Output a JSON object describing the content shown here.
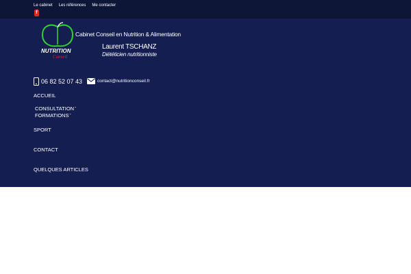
{
  "topbar": {
    "links": [
      "Le cabinet",
      "Les références",
      "Me contacter"
    ],
    "social_icon": "facebook-icon",
    "social_glyph": "f"
  },
  "header": {
    "logo_text": "NUTRITION",
    "logo_subtext": "Conseil",
    "site_title": "Cabinet Conseil en Nutrition & Alimentation",
    "person_name": "Laurent TSCHANZ",
    "person_role": "Diététicien nutritionniste"
  },
  "contact": {
    "phone": "06 82 52 07 43",
    "email": "contact@nutritionconseil.fr",
    "phone_icon": "phone-icon",
    "email_icon": "envelope-icon"
  },
  "nav": {
    "items": [
      {
        "label": "ACCUEIL"
      },
      {
        "label": "CONSULTATION"
      },
      {
        "label": "FORMATIONS"
      },
      {
        "label": "SPORT"
      },
      {
        "label": "CONTACT"
      },
      {
        "label": "QUELQUES ARTICLES"
      }
    ],
    "chevron_icon": "chevron-down-icon"
  },
  "colors": {
    "topbar_bg": "#0e1638",
    "main_bg": "#141e50",
    "logo_green": "#2fd02f",
    "logo_red": "#e02828"
  }
}
